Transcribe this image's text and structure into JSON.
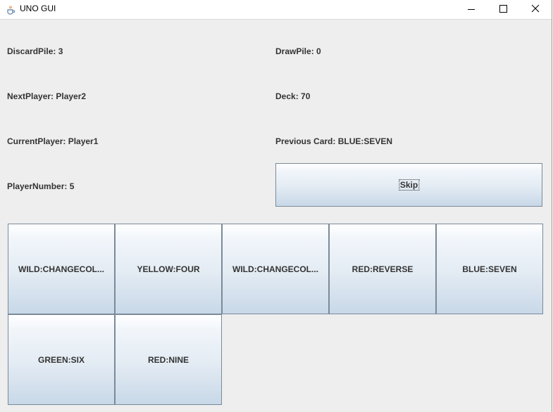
{
  "window": {
    "title": "UNO GUI"
  },
  "info": {
    "discard_pile": "DiscardPile: 3",
    "draw_pile": "DrawPile: 0",
    "next_player": "NextPlayer: Player2",
    "deck": "Deck: 70",
    "current_player": "CurrentPlayer: Player1",
    "previous_card": "Previous Card: BLUE:SEVEN",
    "player_number": "PlayerNumber: 5"
  },
  "actions": {
    "skip_label": "Skip"
  },
  "hand": {
    "cards": [
      {
        "label": "WILD:CHANGECOL..."
      },
      {
        "label": "YELLOW:FOUR"
      },
      {
        "label": "WILD:CHANGECOL..."
      },
      {
        "label": "RED:REVERSE"
      },
      {
        "label": "BLUE:SEVEN"
      },
      {
        "label": "GREEN:SIX"
      },
      {
        "label": "RED:NINE"
      }
    ]
  },
  "icons": {
    "app": "java-cup-icon",
    "minimize": "minimize-icon",
    "maximize": "maximize-icon",
    "close": "close-icon"
  }
}
